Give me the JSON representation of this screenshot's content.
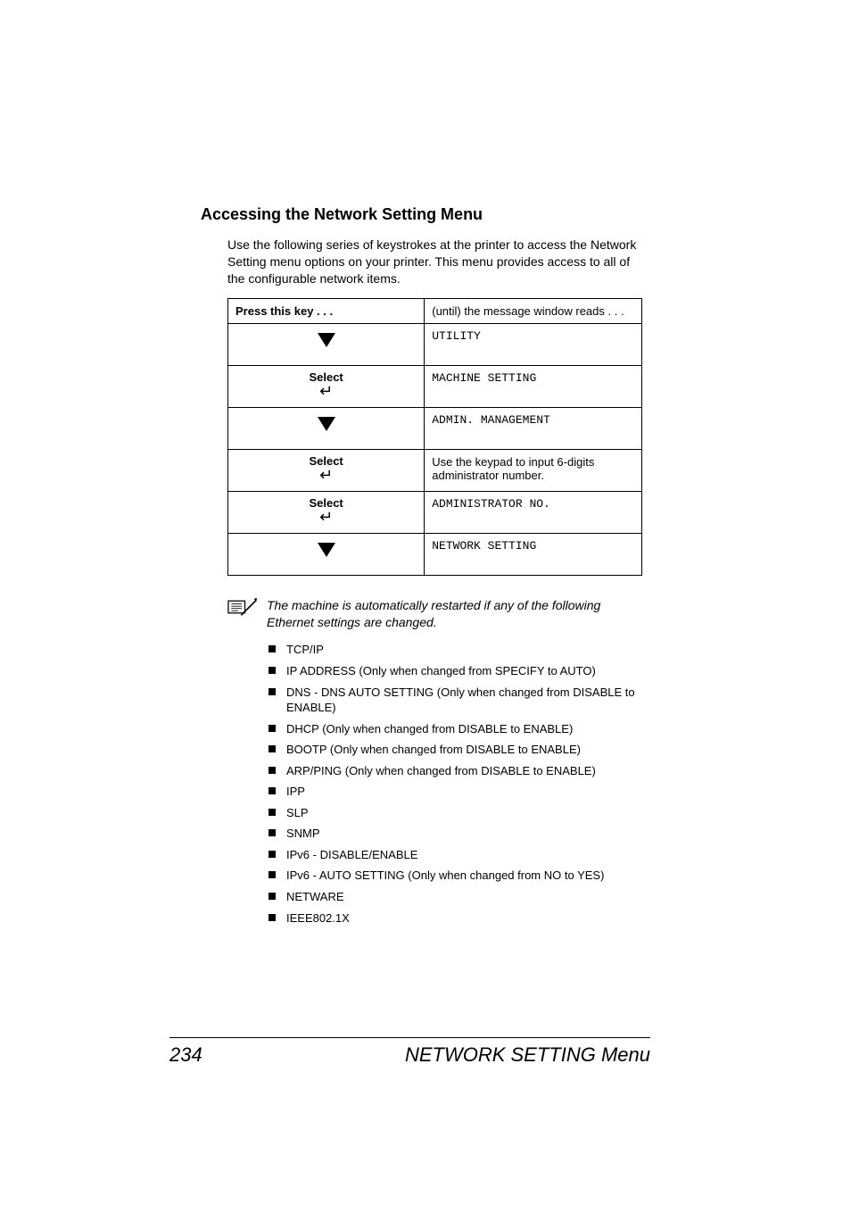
{
  "heading": "Accessing the Network Setting Menu",
  "intro": "Use the following series of keystrokes at the printer to access the Network Setting menu options on your printer. This menu provides access to all of the configurable network items.",
  "table": {
    "header": {
      "c1": "Press this key . . .",
      "c2": "(until) the message window reads . . ."
    },
    "rows": [
      {
        "key": "down",
        "text": "UTILITY",
        "mono": true
      },
      {
        "key": "select",
        "text": "MACHINE SETTING",
        "mono": true
      },
      {
        "key": "down",
        "text": "ADMIN. MANAGEMENT",
        "mono": true
      },
      {
        "key": "select",
        "text": "Use the keypad to input 6-digits administrator number.",
        "mono": false
      },
      {
        "key": "select",
        "text": "ADMINISTRATOR NO.",
        "mono": true
      },
      {
        "key": "down",
        "text": "NETWORK SETTING",
        "mono": true
      }
    ]
  },
  "keys": {
    "select_label": "Select"
  },
  "note": "The machine is automatically restarted if any of the following Ethernet settings are changed.",
  "bullets": [
    "TCP/IP",
    "IP ADDRESS (Only when changed from SPECIFY to AUTO)",
    "DNS - DNS AUTO SETTING (Only when changed from DISABLE to ENABLE)",
    "DHCP (Only when changed from DISABLE to ENABLE)",
    "BOOTP (Only when changed from DISABLE to ENABLE)",
    "ARP/PING (Only when changed from DISABLE to ENABLE)",
    "IPP",
    "SLP",
    "SNMP",
    "IPv6 - DISABLE/ENABLE",
    "IPv6 - AUTO SETTING (Only when changed from NO to YES)",
    "NETWARE",
    "IEEE802.1X"
  ],
  "footer": {
    "page": "234",
    "title": "NETWORK SETTING Menu"
  }
}
